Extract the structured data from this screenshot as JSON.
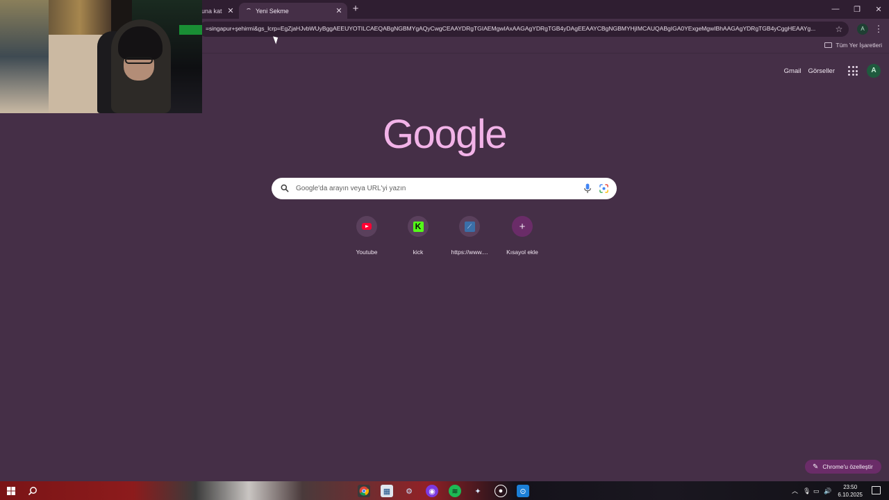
{
  "browser": {
    "tabs": [
      {
        "title": "una kat",
        "active": false
      },
      {
        "title": "Yeni Sekme",
        "active": true
      }
    ],
    "new_tab_label": "+",
    "url": "=singapur+şehirmi&gs_lcrp=EgZjaHJvbWUyBggAEEUYOTILCAEQABgNGBMYgAQyCwgCEAAYDRgTGIAEMgwIAxAAGAgYDRgTGB4yDAgEEAAYCBgNGBMYHjIMCAUQABgIGA0YExgeMgwIBhAAGAgYDRgTGB4yCggHEAAYg...",
    "bookmarks_all_label": "Tüm Yer İşaretleri",
    "profile_initial": "A"
  },
  "ntp": {
    "links": {
      "gmail": "Gmail",
      "images": "Görseller"
    },
    "avatar_initial": "A",
    "logo_text": "Google",
    "search_placeholder": "Google'da arayın veya URL'yi yazın",
    "shortcuts": [
      {
        "label": "Youtube",
        "icon": "youtube-icon"
      },
      {
        "label": "kick",
        "icon": "kick-icon",
        "glyph": "K"
      },
      {
        "label": "https://www....",
        "icon": "site-icon",
        "glyph": "⟋"
      },
      {
        "label": "Kısayol ekle",
        "icon": "plus-icon",
        "glyph": "+"
      }
    ],
    "customize_label": "Chrome'u özelleştir"
  },
  "taskbar": {
    "time": "23:50",
    "date": "6.10.2025"
  },
  "colors": {
    "background": "#452f47",
    "tab_strip": "#2f1e31",
    "logo": "#f2b3e8",
    "accent": "#6a2c68"
  }
}
